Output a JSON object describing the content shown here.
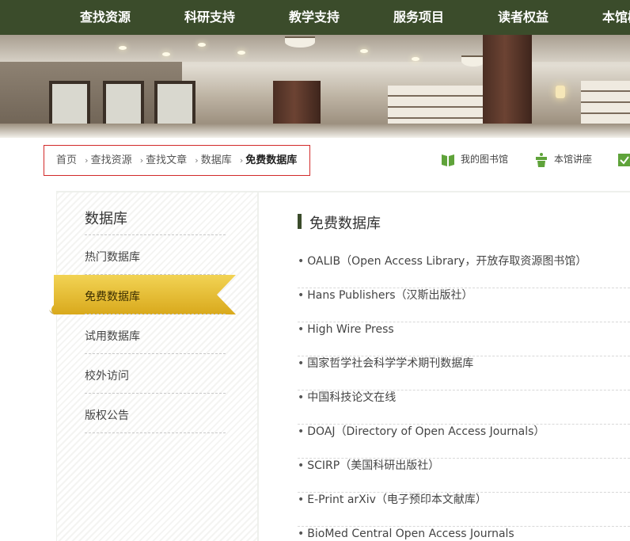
{
  "nav": {
    "items": [
      {
        "label": "查找资源"
      },
      {
        "label": "科研支持"
      },
      {
        "label": "教学支持"
      },
      {
        "label": "服务项目"
      },
      {
        "label": "读者权益"
      },
      {
        "label": "本馆概"
      }
    ]
  },
  "breadcrumb": {
    "items": [
      "首页",
      "查找资源",
      "查找文章",
      "数据库"
    ],
    "current": "免费数据库"
  },
  "quick_links": {
    "my_library": "我的图书馆",
    "lectures": "本馆讲座"
  },
  "sidebar": {
    "title": "数据库",
    "items": [
      {
        "label": "热门数据库"
      },
      {
        "label": "免费数据库"
      },
      {
        "label": "试用数据库"
      },
      {
        "label": "校外访问"
      },
      {
        "label": "版权公告"
      }
    ]
  },
  "main": {
    "title": "免费数据库",
    "bullet": "•",
    "items": [
      {
        "label": "OALIB（Open Access Library，开放存取资源图书馆）"
      },
      {
        "label": "Hans Publishers（汉斯出版社）"
      },
      {
        "label": "High Wire Press"
      },
      {
        "label": "国家哲学社会科学学术期刊数据库"
      },
      {
        "label": "中国科技论文在线"
      },
      {
        "label": "DOAJ（Directory of Open Access Journals）"
      },
      {
        "label": "SCIRP（美国科研出版社）"
      },
      {
        "label": "E-Print arXiv（电子预印本文献库）"
      },
      {
        "label": "BioMed Central Open Access Journals"
      }
    ]
  },
  "colors": {
    "nav_bg": "#3b4c2b",
    "active_tab": "#e8c23a",
    "breadcrumb_border": "#d22a2a",
    "icon_green": "#5fa33a"
  }
}
